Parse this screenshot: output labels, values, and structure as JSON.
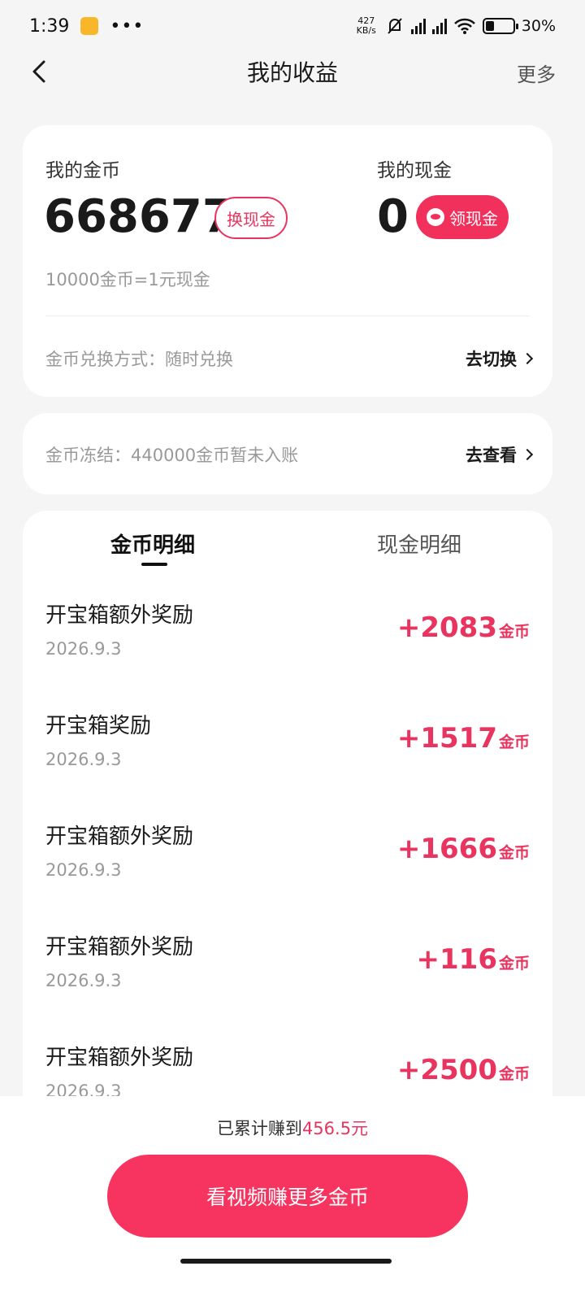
{
  "status_bar": {
    "time": "1:39",
    "speed_value": "427",
    "speed_unit": "KB/s",
    "battery_pct": "30%",
    "battery_level": 0.3
  },
  "nav": {
    "title": "我的收益",
    "more": "更多"
  },
  "balance": {
    "coins_label": "我的金币",
    "coins_value": "668677",
    "exchange_button": "换现金",
    "cash_label": "我的现金",
    "cash_value": "0",
    "claim_button": "领现金",
    "rate": "10000金币=1元现金",
    "mode_text": "金币兑换方式：随时兑换",
    "mode_link": "去切换"
  },
  "frozen": {
    "text": "金币冻结：440000金币暂未入账",
    "link": "去查看"
  },
  "tabs": {
    "active": "金币明细",
    "inactive": "现金明细"
  },
  "records": [
    {
      "title": "开宝箱额外奖励",
      "date": "2026.9.3",
      "amount": "+2083",
      "unit": "金币"
    },
    {
      "title": "开宝箱奖励",
      "date": "2026.9.3",
      "amount": "+1517",
      "unit": "金币"
    },
    {
      "title": "开宝箱额外奖励",
      "date": "2026.9.3",
      "amount": "+1666",
      "unit": "金币"
    },
    {
      "title": "开宝箱额外奖励",
      "date": "2026.9.3",
      "amount": "+116",
      "unit": "金币"
    },
    {
      "title": "开宝箱额外奖励",
      "date": "2026.9.3",
      "amount": "+2500",
      "unit": "金币"
    }
  ],
  "footer": {
    "total_prefix": "已累计赚到",
    "total_value": "456.5元",
    "cta": "看视频赚更多金币"
  },
  "colors": {
    "accent": "#e8345e",
    "cta": "#f6345f"
  }
}
